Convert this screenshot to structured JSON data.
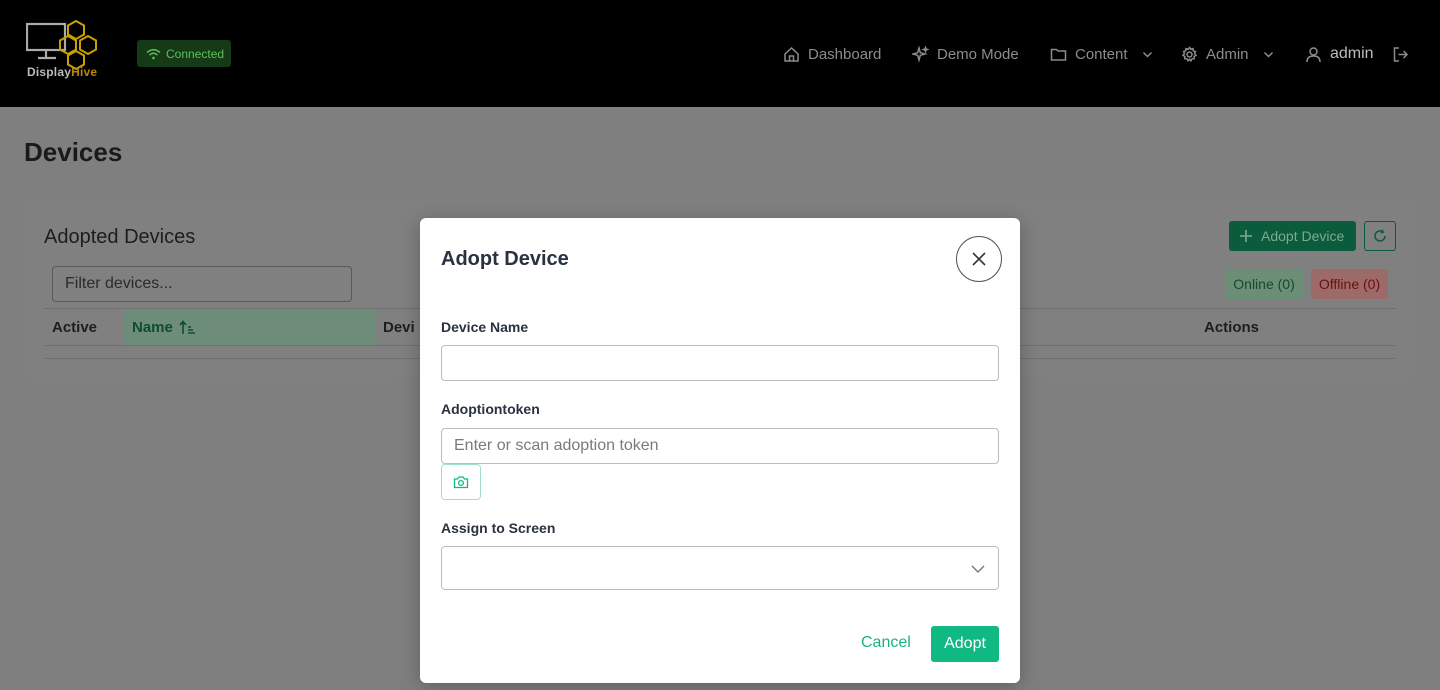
{
  "header": {
    "logo_text_a": "Display",
    "logo_text_b": "Hive",
    "connection_status": "Connected",
    "nav": {
      "dashboard": "Dashboard",
      "demo_mode": "Demo Mode",
      "content": "Content",
      "admin": "Admin",
      "user": "admin"
    }
  },
  "page": {
    "title": "Devices",
    "card_title": "Adopted Devices",
    "filter_placeholder": "Filter devices...",
    "adopt_button": "Adopt Device",
    "online_pill": "Online (0)",
    "offline_pill": "Offline (0)",
    "table": {
      "columns": [
        "Active",
        "Name",
        "Devi",
        "Actions"
      ]
    }
  },
  "modal": {
    "title": "Adopt Device",
    "device_name_label": "Device Name",
    "device_name_value": "",
    "token_label": "Adoptiontoken",
    "token_placeholder": "Enter or scan adoption token",
    "screen_label": "Assign to Screen",
    "screen_value": "",
    "cancel_label": "Cancel",
    "adopt_label": "Adopt"
  },
  "colors": {
    "accent": "#10b981",
    "header_bg": "#000000",
    "overlay": "#7f7f7f"
  }
}
